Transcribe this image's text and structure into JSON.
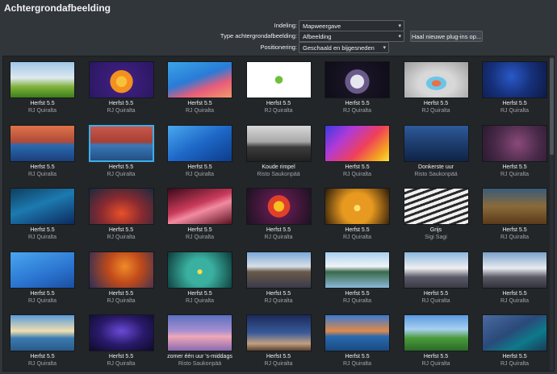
{
  "title": "Achtergrondafbeelding",
  "form": {
    "layout": {
      "label": "Indeling:",
      "value": "Mapweergave"
    },
    "type": {
      "label": "Type achtergrondafbeelding:",
      "value": "Afbeelding"
    },
    "get_plugins_label": "Haal nieuwe plug-ins op...",
    "positioning": {
      "label": "Positionering:",
      "value": "Geschaald en bijgesneden"
    }
  },
  "wallpapers": [
    {
      "name": "Herfst 5.5",
      "author": "RJ Quiralta",
      "bg": "linear-gradient(180deg,#9fc6e8 0%,#dfe9ef 45%,#7eb23a 70%,#3d7d1c 100%)",
      "selected": false
    },
    {
      "name": "Herfst 5.5",
      "author": "RJ Quiralta",
      "bg": "radial-gradient(circle at 50% 55%,#f6c23a 0 14%,#f39020 15% 30%,#3b1e7a 31%,#2a1760 100%)",
      "selected": false
    },
    {
      "name": "Herfst 5.5",
      "author": "RJ Quiralta",
      "bg": "linear-gradient(160deg,#3aa4e8 0%,#2a7bd6 45%,#e95c7a 70%,#f29a6a 100%)",
      "selected": false
    },
    {
      "name": "Herfst 5.5",
      "author": "RJ Quiralta",
      "bg": "radial-gradient(circle at 50% 50%,#6fbf3a 0 10%,#ffffff 11% 100%)",
      "selected": false
    },
    {
      "name": "Herfst 5.5",
      "author": "RJ Quiralta",
      "bg": "radial-gradient(circle at 50% 55%,#e6e6ef 0 18%,#6a5a8a 19% 32%,#181424 33%,#0f0c18 100%)",
      "selected": false
    },
    {
      "name": "Herfst 5.5",
      "author": "RJ Quiralta",
      "bg": "radial-gradient(ellipse at 50% 60%,#e8704a 0 10%,#6ac6e8 11% 22%,#d8d8d8 23% 40%,#9c9c9c 100%)",
      "selected": false
    },
    {
      "name": "Herfst 5.5",
      "author": "RJ Quiralta",
      "bg": "radial-gradient(circle at 45% 40%,#2a59c8 0%,#16307a 50%,#0d1a44 100%)",
      "selected": false
    },
    {
      "name": "Herfst 5.5",
      "author": "RJ Quiralta",
      "bg": "linear-gradient(180deg,#e0744a 0%,#b04a38 45%,#2a6ab0 55%,#1b3f7a 100%)",
      "selected": false
    },
    {
      "name": "Herfst 5.5",
      "author": "RJ Quiralta",
      "bg": "linear-gradient(180deg,#c8574a 0%,#a84035 45%,#3a78b8 55%,#244f84 100%)",
      "selected": true
    },
    {
      "name": "Herfst 5.5",
      "author": "RJ Quiralta",
      "bg": "linear-gradient(150deg,#4aa8ee 0%,#1e68c8 50%,#0d3b8a 100%)",
      "selected": false
    },
    {
      "name": "Koude rimpel",
      "author": "Risto Saukonpää",
      "bg": "linear-gradient(180deg,#d8d8d8 0%,#a8a8a8 45%,#3c3c3c 60%,#202020 100%)",
      "selected": false
    },
    {
      "name": "Herfst 5.5",
      "author": "RJ Quiralta",
      "bg": "linear-gradient(135deg,#3b3be0 0%,#b03ad8 30%,#f0405a 60%,#f5a620 85%,#f5e040 100%)",
      "selected": false
    },
    {
      "name": "Donkerste uur",
      "author": "Risto Saukonpää",
      "bg": "linear-gradient(180deg,#2e5a9a 0%,#1c3a6a 55%,#0f2446 100%)",
      "selected": false
    },
    {
      "name": "Herfst 5.5",
      "author": "RJ Quiralta",
      "bg": "radial-gradient(circle at 55% 50%,#8a4a7a 0%,#4a2a4a 55%,#2a1a2e 100%)",
      "selected": false
    },
    {
      "name": "Herfst 5.5",
      "author": "RJ Quiralta",
      "bg": "linear-gradient(160deg,#0d3e5e 0%,#1c7ab0 45%,#0d2a5e 100%)",
      "selected": false
    },
    {
      "name": "Herfst 5.5",
      "author": "RJ Quiralta",
      "bg": "radial-gradient(ellipse at 50% 70%,#e8502a 0%,#8a2a30 45%,#1a2a3e 100%)",
      "selected": false
    },
    {
      "name": "Herfst 5.5",
      "author": "RJ Quiralta",
      "bg": "linear-gradient(160deg,#3a0a1a 0%,#c83a5a 45%,#f28aa0 60%,#5a1020 100%)",
      "selected": false
    },
    {
      "name": "Herfst 5.5",
      "author": "RJ Quiralta",
      "bg": "radial-gradient(circle at 50% 50%,#f5c020 0 14%,#e0402a 15% 30%,#5a1a4a 31%,#1c1220 100%)",
      "selected": false
    },
    {
      "name": "Herfst 5.5",
      "author": "RJ Quiralta",
      "bg": "radial-gradient(circle at 50% 55%,#ffe070 0 8%,#e89a20 9% 40%,#2a1a0a 100%)",
      "selected": false
    },
    {
      "name": "Grijs",
      "author": "Sigi Sagi",
      "bg": "repeating-linear-gradient(160deg,#f0f0f0 0 4px,#2a2a2a 4px 7px)",
      "selected": false
    },
    {
      "name": "Herfst 5.5",
      "author": "RJ Quiralta",
      "bg": "linear-gradient(180deg,#3a5a7a 0%,#8a6a3a 50%,#5a3a1a 100%)",
      "selected": false
    },
    {
      "name": "Herfst 5.5",
      "author": "RJ Quiralta",
      "bg": "linear-gradient(160deg,#4aa6f0 0%,#2a74d0 60%,#1a4fa0 100%)",
      "selected": false
    },
    {
      "name": "Herfst 5.5",
      "author": "RJ Quiralta",
      "bg": "radial-gradient(circle at 55% 40%,#f08a2a 0%,#c04a1a 40%,#2a2e5a 100%)",
      "selected": false
    },
    {
      "name": "Herfst 5.5",
      "author": "RJ Quiralta",
      "bg": "radial-gradient(circle at 50% 55%,#f0e050 0 6%,#3ab0a0 7% 35%,#0d3a3a 100%)",
      "selected": false
    },
    {
      "name": "Herfst 5.5",
      "author": "RJ Quiralta",
      "bg": "linear-gradient(180deg,#7aa8d8 0%,#d8e0e8 40%,#6a5a4a 55%,#3a3a4a 100%)",
      "selected": false
    },
    {
      "name": "Herfst 5.5",
      "author": "RJ Quiralta",
      "bg": "linear-gradient(180deg,#a8d0f0 0%,#f0f4f8 40%,#3a6a4a 55%,#8ab8d8 100%)",
      "selected": false
    },
    {
      "name": "Herfst 5.5",
      "author": "RJ Quiralta",
      "bg": "linear-gradient(180deg,#8ab8e0 0%,#f0f0f0 45%,#5a5a6a 70%,#3a3a44 100%)",
      "selected": false
    },
    {
      "name": "Herfst 5.5",
      "author": "RJ Quiralta",
      "bg": "linear-gradient(180deg,#7aa0c8 0%,#e8ecf0 45%,#5a5a66 70%,#32323c 100%)",
      "selected": false
    },
    {
      "name": "Herfst 5.5",
      "author": "RJ Quiralta",
      "bg": "linear-gradient(180deg,#5a9ad8 0%,#f0e0b0 45%,#3a7ab0 65%,#2a5a8a 100%)",
      "selected": false
    },
    {
      "name": "Herfst 5.5",
      "author": "RJ Quiralta",
      "bg": "radial-gradient(ellipse at 50% 45%,#6a4ad8 0%,#2a1a6a 50%,#0d0a2a 100%)",
      "selected": false
    },
    {
      "name": "zomer één uur 's-middags",
      "author": "Risto Saukonpää",
      "bg": "linear-gradient(180deg,#5a70c0 0%,#a890d0 45%,#f0a8b8 60%,#8a6ab0 100%)",
      "selected": false
    },
    {
      "name": "Herfst 5.5",
      "author": "RJ Quiralta",
      "bg": "linear-gradient(180deg,#1a2a5a 0%,#3a5a9a 50%,#c0a080 80%,#5a4030 100%)",
      "selected": false
    },
    {
      "name": "Herfst 5.5",
      "author": "RJ Quiralta",
      "bg": "linear-gradient(180deg,#3a7ad0 0%,#e08a4a 45%,#2a6ab0 60%,#1a4a80 100%)",
      "selected": false
    },
    {
      "name": "Herfst 5.5",
      "author": "RJ Quiralta",
      "bg": "linear-gradient(180deg,#5a9ae0 0%,#a8d0f0 40%,#4a9a3a 65%,#2a6a2a 100%)",
      "selected": false
    },
    {
      "name": "Herfst 5.5",
      "author": "RJ Quiralta",
      "bg": "linear-gradient(150deg,#4a6aa0 0%,#2a4a7a 45%,#0d7a8a 70%,#1a3a5a 100%)",
      "selected": false
    }
  ]
}
